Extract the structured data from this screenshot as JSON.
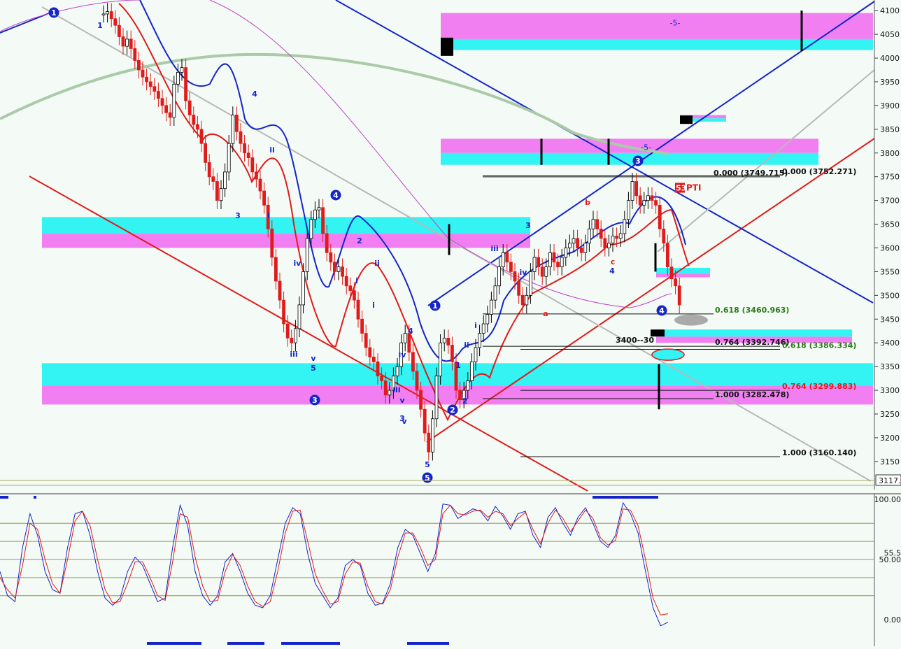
{
  "colors": {
    "background": "#f4fbf6",
    "cyan": "#33f3f3",
    "magenta": "#f27ff2",
    "red": "#e01b1b",
    "blue": "#1525c8",
    "gray": "#b8b8b8",
    "ma_green": "#aacaa8",
    "purple": "#c040c8",
    "fib_green": "#2a7a18",
    "fib_black": "#111111",
    "osc_level": "#9a9a3a"
  },
  "chart_data": [
    {
      "type": "candlestick",
      "title": "",
      "y_axis": {
        "ylim": [
          3110,
          4115
        ],
        "ticks": [
          4100,
          4050,
          4000,
          3950,
          3900,
          3850,
          3800,
          3750,
          3700,
          3650,
          3600,
          3550,
          3500,
          3450,
          3400,
          3350,
          3300,
          3250,
          3200,
          3150
        ],
        "position": "right",
        "last_price_label": "3117."
      },
      "grid": false,
      "zones": [
        {
          "label": "-5-",
          "upper": 4095,
          "lower": 4017,
          "colors": [
            "magenta",
            "cyan"
          ]
        },
        {
          "label": "",
          "upper": 3880,
          "lower": 3866,
          "colors": [
            "magenta",
            "cyan"
          ]
        },
        {
          "label": "-5-",
          "upper": 3830,
          "lower": 3775,
          "colors": [
            "magenta",
            "cyan"
          ]
        },
        {
          "label": "",
          "upper": 3665,
          "lower": 3600,
          "colors": [
            "cyan",
            "magenta"
          ]
        },
        {
          "label": "",
          "upper": 3357,
          "lower": 3270,
          "colors": [
            "cyan",
            "magenta"
          ]
        },
        {
          "label": "",
          "upper": 3558,
          "lower": 3538,
          "colors": [
            "cyan",
            "magenta"
          ]
        },
        {
          "label": "",
          "upper": 3428,
          "lower": 3400,
          "colors": [
            "cyan",
            "magenta"
          ]
        }
      ],
      "fib_levels": [
        {
          "text": "0.000 (3749.715)",
          "value": 3749.715
        },
        {
          "text": "0.000 (3752.271)",
          "value": 3752.271
        },
        {
          "text": "0.618 (3460.963)",
          "value": 3460.963
        },
        {
          "text": "0.764 (3392.746)",
          "value": 3392.746
        },
        {
          "text": "0.618 (3386.334)",
          "value": 3386.334
        },
        {
          "text": "0.764 (3299.883)",
          "value": 3299.883
        },
        {
          "text": "1.000 (3282.478)",
          "value": 3282.478
        },
        {
          "text": "1.000 (3160.140)",
          "value": 3160.14
        }
      ],
      "annotations": [
        "53",
        "PTI",
        "3400--30"
      ],
      "wave_labels": [
        {
          "text": "1",
          "circled": true,
          "color": "blue"
        },
        {
          "text": "1",
          "circled": false,
          "color": "blue"
        },
        {
          "text": "4",
          "circled": false,
          "color": "blue"
        },
        {
          "text": "ii",
          "circled": false,
          "color": "blue"
        },
        {
          "text": "3",
          "circled": false,
          "color": "blue"
        },
        {
          "text": "i",
          "circled": false,
          "color": "blue"
        },
        {
          "text": "iv",
          "circled": false,
          "color": "blue"
        },
        {
          "text": "iii",
          "circled": false,
          "color": "blue"
        },
        {
          "text": "v",
          "circled": false,
          "color": "blue"
        },
        {
          "text": "5",
          "circled": false,
          "color": "blue"
        },
        {
          "text": "3",
          "circled": true,
          "color": "blue"
        },
        {
          "text": "4",
          "circled": true,
          "color": "blue"
        },
        {
          "text": "2",
          "circled": false,
          "color": "blue"
        },
        {
          "text": "ii",
          "circled": false,
          "color": "blue"
        },
        {
          "text": "i",
          "circled": false,
          "color": "blue"
        },
        {
          "text": "i",
          "circled": false,
          "color": "blue"
        },
        {
          "text": "4",
          "circled": false,
          "color": "blue"
        },
        {
          "text": "iv",
          "circled": false,
          "color": "blue"
        },
        {
          "text": "iii",
          "circled": false,
          "color": "blue"
        },
        {
          "text": "v",
          "circled": false,
          "color": "blue"
        },
        {
          "text": "3",
          "circled": false,
          "color": "blue"
        },
        {
          "text": "5",
          "circled": false,
          "color": "blue"
        },
        {
          "text": "5",
          "circled": true,
          "color": "blue"
        },
        {
          "text": "1",
          "circled": true,
          "color": "blue"
        },
        {
          "text": "2",
          "circled": true,
          "color": "blue"
        },
        {
          "text": "1",
          "circled": false,
          "color": "blue"
        },
        {
          "text": "2",
          "circled": false,
          "color": "blue"
        },
        {
          "text": "ii",
          "circled": false,
          "color": "blue"
        },
        {
          "text": "i",
          "circled": false,
          "color": "blue"
        },
        {
          "text": "iii",
          "circled": false,
          "color": "blue"
        },
        {
          "text": "3",
          "circled": false,
          "color": "blue"
        },
        {
          "text": "v",
          "circled": false,
          "color": "blue"
        },
        {
          "text": "iv",
          "circled": false,
          "color": "blue"
        },
        {
          "text": "a",
          "circled": false,
          "color": "red"
        },
        {
          "text": "b",
          "circled": false,
          "color": "red"
        },
        {
          "text": "c",
          "circled": false,
          "color": "red"
        },
        {
          "text": "4",
          "circled": false,
          "color": "blue"
        },
        {
          "text": "3",
          "circled": true,
          "color": "blue"
        },
        {
          "text": "4",
          "circled": true,
          "color": "blue"
        }
      ],
      "series": [
        {
          "values": [
            4093,
            4098,
            4083,
            4069,
            4045,
            4025,
            4040,
            4020,
            3995,
            3975,
            3960,
            3950,
            3940,
            3930,
            3915,
            3900,
            3885,
            3875,
            3945,
            3970,
            3980,
            3910,
            3880,
            3860,
            3850,
            3820,
            3780,
            3750,
            3740,
            3700,
            3725,
            3760,
            3820,
            3880,
            3845,
            3820,
            3800,
            3790,
            3760,
            3745,
            3720,
            3690,
            3640,
            3580,
            3530,
            3490,
            3440,
            3410,
            3400,
            3430,
            3480,
            3550,
            3620,
            3660,
            3680,
            3685,
            3630,
            3590,
            3570,
            3550,
            3560,
            3540,
            3520,
            3510,
            3490,
            3450,
            3420,
            3390,
            3370,
            3360,
            3330,
            3320,
            3290,
            3300,
            3330,
            3350,
            3400,
            3420,
            3380,
            3340,
            3300,
            3260,
            3210,
            3170,
            3240,
            3330,
            3400,
            3410,
            3395,
            3360,
            3300,
            3280,
            3300,
            3320,
            3360,
            3390,
            3420,
            3440,
            3460,
            3490,
            3520,
            3560,
            3590,
            3570,
            3550,
            3530,
            3500,
            3480,
            3500,
            3550,
            3580,
            3560,
            3540,
            3560,
            3590,
            3570,
            3560,
            3580,
            3600,
            3610,
            3620,
            3600,
            3590,
            3610,
            3640,
            3660,
            3640,
            3620,
            3600,
            3610,
            3625,
            3620,
            3630,
            3660,
            3700,
            3740,
            3710,
            3690,
            3700,
            3710,
            3700,
            3690,
            3640,
            3610,
            3560,
            3535,
            3520,
            3480
          ]
        }
      ]
    },
    {
      "type": "line",
      "title": "",
      "y_axis": {
        "ylim": [
          -8,
          108
        ],
        "tick_labels": [
          "100.00",
          "50.00",
          "0.00"
        ],
        "last_value_label": "55.5",
        "levels": [
          80,
          65,
          50,
          35,
          20
        ],
        "position": "right"
      },
      "grid": false,
      "series": [
        {
          "color": "blue",
          "values": [
            40,
            20,
            15,
            60,
            88,
            70,
            40,
            25,
            22,
            60,
            88,
            90,
            70,
            40,
            18,
            12,
            18,
            40,
            52,
            45,
            30,
            15,
            18,
            60,
            95,
            78,
            40,
            20,
            12,
            20,
            48,
            55,
            40,
            22,
            12,
            10,
            20,
            50,
            80,
            93,
            88,
            55,
            30,
            20,
            10,
            18,
            45,
            50,
            45,
            22,
            12,
            14,
            30,
            60,
            75,
            70,
            55,
            40,
            55,
            96,
            95,
            84,
            88,
            92,
            90,
            82,
            94,
            86,
            75,
            88,
            90,
            70,
            60,
            85,
            93,
            80,
            70,
            85,
            93,
            80,
            65,
            60,
            70,
            97,
            88,
            72,
            40,
            10,
            -5,
            -2
          ]
        },
        {
          "color": "red",
          "values": [
            35,
            25,
            18,
            45,
            80,
            75,
            50,
            30,
            22,
            50,
            82,
            90,
            78,
            50,
            25,
            14,
            15,
            30,
            48,
            48,
            35,
            20,
            16,
            48,
            88,
            85,
            52,
            28,
            15,
            16,
            40,
            54,
            45,
            28,
            15,
            11,
            15,
            40,
            72,
            90,
            91,
            65,
            38,
            24,
            13,
            15,
            38,
            48,
            47,
            28,
            15,
            13,
            25,
            52,
            72,
            72,
            60,
            45,
            50,
            88,
            95,
            88,
            87,
            90,
            91,
            85,
            90,
            88,
            78,
            84,
            89,
            75,
            63,
            80,
            91,
            84,
            73,
            82,
            91,
            84,
            68,
            62,
            66,
            92,
            91,
            78,
            50,
            18,
            4,
            5
          ]
        }
      ]
    }
  ]
}
